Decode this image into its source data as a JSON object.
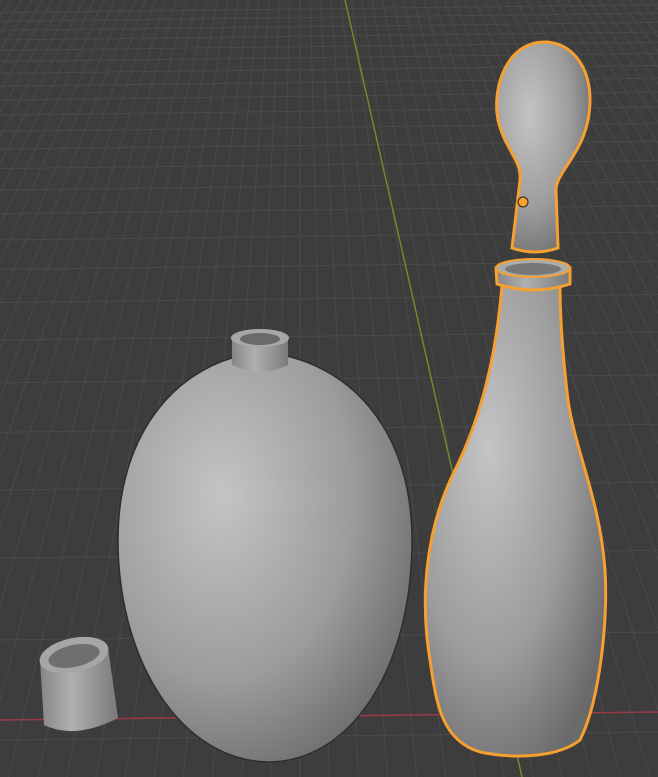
{
  "viewport": {
    "background_color": "#3d3d3d",
    "grid_color": "#4a4a4a",
    "axis_y_color": "#6b8c2a",
    "axis_x_color": "#9a3a48",
    "selection_outline_color": "#f5a030",
    "object_color": "#9a9a9a"
  }
}
